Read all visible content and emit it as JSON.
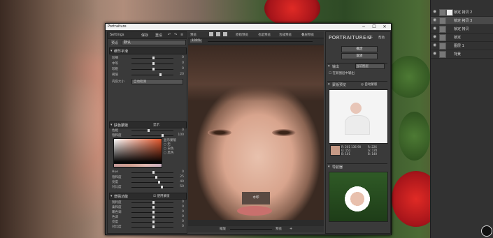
{
  "plugin": {
    "title": "Portraiture",
    "brand": "PORTRAITURE 2",
    "window_buttons": [
      "─",
      "☐",
      "✕"
    ],
    "top_menu": [
      "Settings",
      "保存",
      "重设",
      "↶",
      "↷",
      "≡"
    ],
    "preset_label": "预设",
    "preset_value": "默认",
    "sections": {
      "detail": "细节平滑",
      "skin": "肤色蒙版",
      "enhance": "增强功能"
    },
    "detail_rows": [
      {
        "name": "较细",
        "value": "0"
      },
      {
        "name": "中等",
        "value": "0"
      },
      {
        "name": "较粗",
        "value": "0"
      },
      {
        "name": "阈值",
        "value": "20"
      }
    ],
    "size_label": "内容大小",
    "size_value": "自动检测",
    "skin_mode": "显示",
    "skin_rows": [
      {
        "name": "色相",
        "value": "0"
      },
      {
        "name": "饱和度",
        "value": "100"
      },
      {
        "name": "模糊",
        "value": "0"
      }
    ],
    "skin_opts": [
      "显示蒙版",
      "无",
      "白色",
      "黑色"
    ],
    "skin_rows2": [
      {
        "name": "Hue",
        "value": "0"
      },
      {
        "name": "饱和度",
        "value": "25"
      },
      {
        "name": "亮度",
        "value": "40"
      },
      {
        "name": "对比度",
        "value": "50"
      }
    ],
    "enhance_check": "使用蒙版",
    "enhance_rows": [
      {
        "name": "锐利度",
        "value": "0"
      },
      {
        "name": "柔和度",
        "value": "0"
      },
      {
        "name": "暖色调",
        "value": "0"
      },
      {
        "name": "色调",
        "value": "0"
      },
      {
        "name": "亮度",
        "value": "0"
      },
      {
        "name": "对比度",
        "value": "0"
      }
    ],
    "center_tools": [
      "预览",
      "",
      "",
      "",
      "原始预览",
      "也是预览",
      "合成预览",
      "叠层预览"
    ],
    "zoom_value": "100%",
    "watermark": "水印",
    "center_bottom": [
      "缩放",
      "",
      "预览",
      "+"
    ],
    "right": {
      "ok": "确定",
      "cancel": "取消",
      "links": [
        "关于",
        "帮助"
      ],
      "output_label": "输出",
      "output_value": "当前图层",
      "new_layer": "在新图层中输出",
      "skin_preview": "蒙版预览",
      "auto_mask": "自动蒙版",
      "info_left": [
        "R: 201  136  90",
        "G: 151",
        "B: 101"
      ],
      "info_right": [
        "R: 226",
        "G: 170",
        "B: 140"
      ],
      "nav_label": "导航器"
    }
  },
  "photoshop_layers": [
    {
      "name": "锁定 拷贝 2",
      "selected": false
    },
    {
      "name": "锁定 拷贝 3",
      "selected": true
    },
    {
      "name": "锁定 拷贝",
      "selected": false
    },
    {
      "name": "锁定",
      "selected": false
    },
    {
      "name": "图层 1",
      "selected": false
    },
    {
      "name": "背景",
      "selected": false
    }
  ],
  "colors": {
    "accent_skin": "#c69a86",
    "panel_bg": "#3a3a3a",
    "window_title_bg": "#f0f0f0"
  }
}
